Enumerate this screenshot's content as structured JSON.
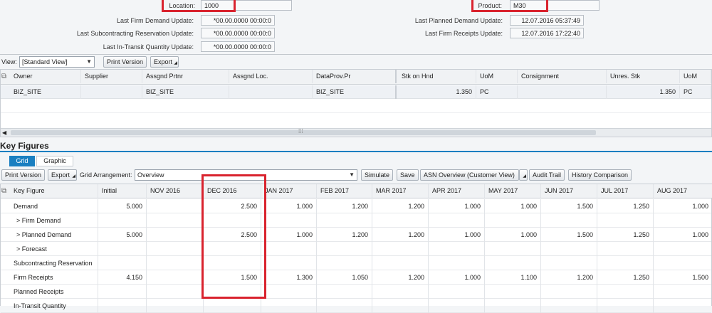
{
  "header": {
    "location_label": "Location:",
    "location_value": "1000",
    "product_label": "Product:",
    "product_value": "M30",
    "left_fields": [
      {
        "label": "Last Firm Demand Update:",
        "value": "*00.00.0000 00:00:0"
      },
      {
        "label": "Last Subcontracting Reservation Update:",
        "value": "*00.00.0000 00:00:0"
      },
      {
        "label": "Last In-Transit Quantity Update:",
        "value": "*00.00.0000 00:00:0"
      }
    ],
    "right_fields": [
      {
        "label": "Last Planned Demand Update:",
        "value": "12.07.2016 05:37:49"
      },
      {
        "label": "Last Firm Receipts Update:",
        "value": "12.07.2016 17:22:40"
      }
    ]
  },
  "toolbar1": {
    "view_label": "View:",
    "view_value": "[Standard View]",
    "print_version": "Print Version",
    "export": "Export"
  },
  "stock_table": {
    "columns": [
      "Owner",
      "Supplier",
      "Assgnd Prtnr",
      "Assgnd Loc.",
      "DataProv.Pr",
      "Stk on Hnd",
      "UoM",
      "Consignment",
      "Unres. Stk",
      "UoM"
    ],
    "rows": [
      [
        "BIZ_SITE",
        "",
        "BIZ_SITE",
        "",
        "BIZ_SITE",
        "1.350",
        "PC",
        "",
        "1.350",
        "PC"
      ]
    ]
  },
  "key_figures": {
    "title": "Key Figures",
    "tabs": [
      "Grid",
      "Graphic"
    ],
    "active_tab": "Grid"
  },
  "toolbar2": {
    "print_version": "Print Version",
    "export": "Export",
    "grid_arrangement_label": "Grid Arrangement:",
    "grid_arrangement_value": "Overview",
    "simulate": "Simulate",
    "save": "Save",
    "asn_overview": "ASN Overview (Customer View)",
    "audit_trail": "Audit Trail",
    "history_comparison": "History Comparison"
  },
  "kf_table": {
    "columns": [
      "Key Figure",
      "Initial",
      "NOV 2016",
      "DEC 2016",
      "JAN 2017",
      "FEB 2017",
      "MAR 2017",
      "APR 2017",
      "MAY 2017",
      "JUN 2017",
      "JUL 2017",
      "AUG 2017"
    ],
    "rows": [
      [
        "Demand",
        "5.000",
        "",
        "2.500",
        "1.000",
        "1.200",
        "1.200",
        "1.000",
        "1.000",
        "1.500",
        "1.250",
        "1.000"
      ],
      [
        "> Firm Demand",
        "",
        "",
        "",
        "",
        "",
        "",
        "",
        "",
        "",
        "",
        ""
      ],
      [
        "> Planned Demand",
        "5.000",
        "",
        "2.500",
        "1.000",
        "1.200",
        "1.200",
        "1.000",
        "1.000",
        "1.500",
        "1.250",
        "1.000"
      ],
      [
        "> Forecast",
        "",
        "",
        "",
        "",
        "",
        "",
        "",
        "",
        "",
        "",
        ""
      ],
      [
        "Subcontracting Reservation",
        "",
        "",
        "",
        "",
        "",
        "",
        "",
        "",
        "",
        "",
        ""
      ],
      [
        "Firm Receipts",
        "4.150",
        "",
        "1.500",
        "1.300",
        "1.050",
        "1.200",
        "1.000",
        "1.100",
        "1.200",
        "1.250",
        "1.500"
      ],
      [
        "Planned Receipts",
        "",
        "",
        "",
        "",
        "",
        "",
        "",
        "",
        "",
        "",
        ""
      ],
      [
        "In-Transit Quantity",
        "",
        "",
        "",
        "",
        "",
        "",
        "",
        "",
        "",
        "",
        ""
      ]
    ]
  },
  "colors": {
    "highlight": "#d9232e",
    "tab_active": "#1a7fc1"
  }
}
